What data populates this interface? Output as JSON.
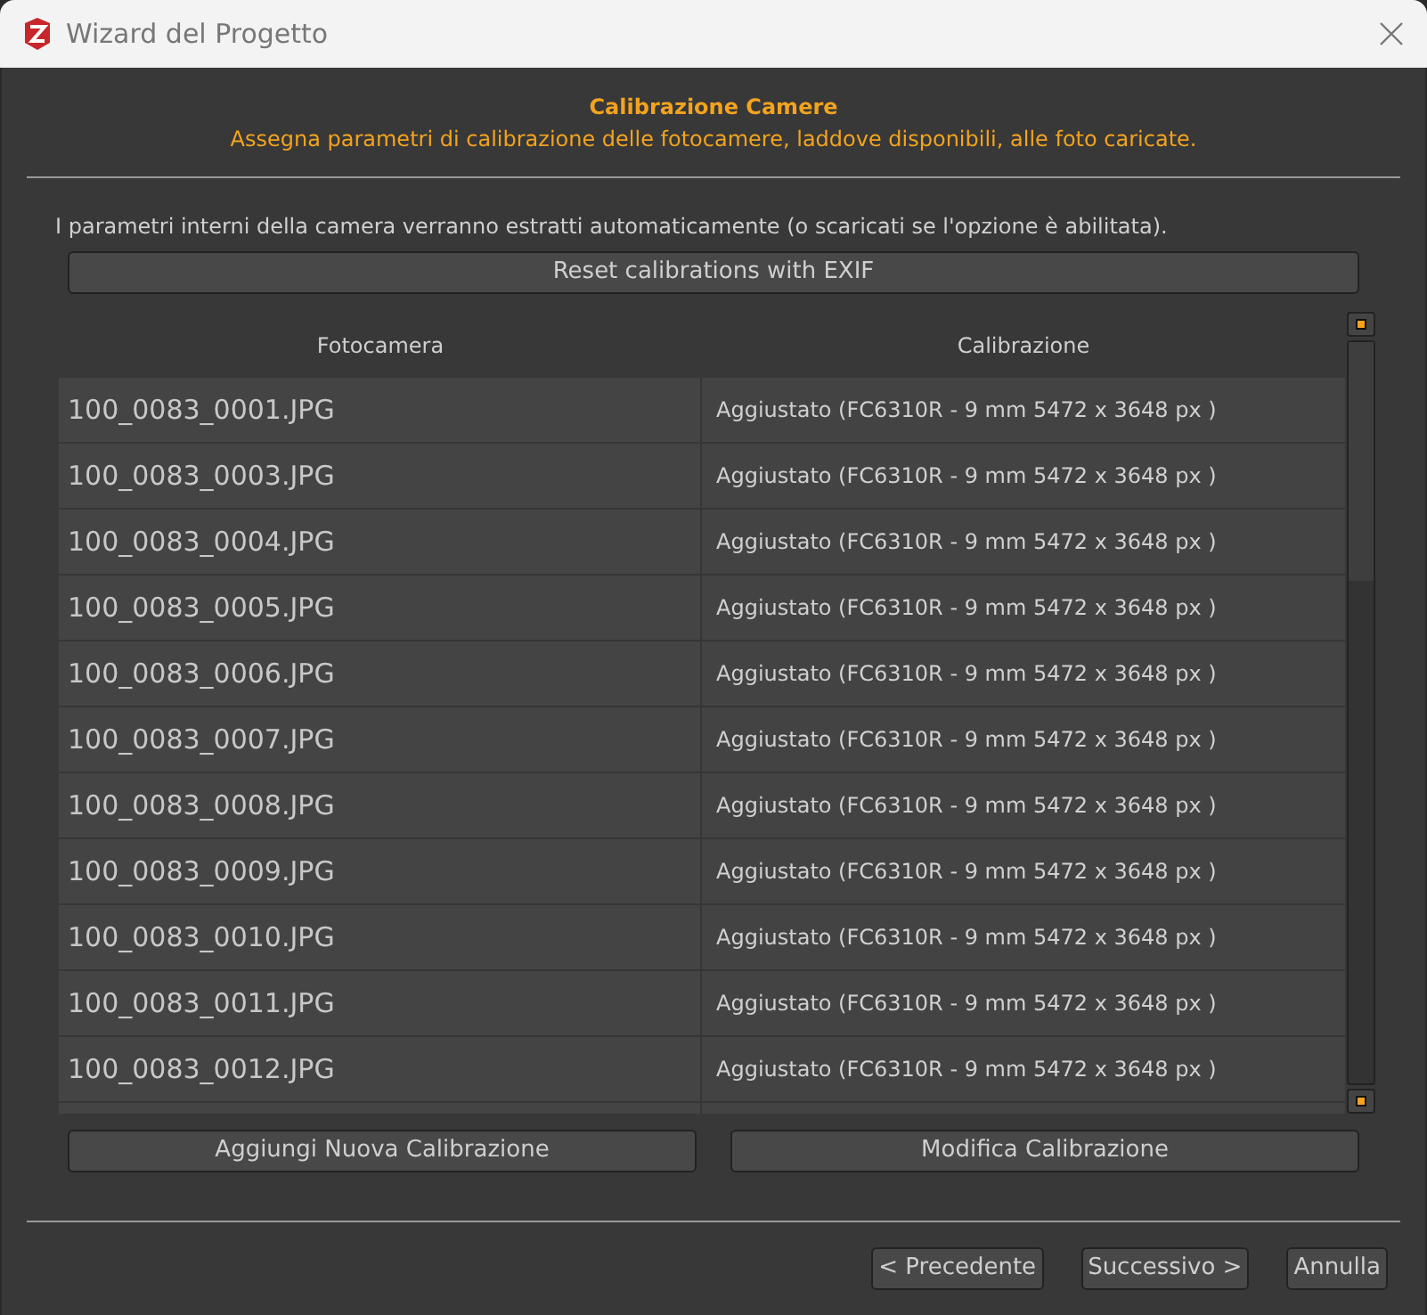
{
  "window": {
    "title": "Wizard del Progetto"
  },
  "header": {
    "title": "Calibrazione Camere",
    "subtitle": "Assegna parametri di calibrazione delle fotocamere, laddove disponibili, alle foto caricate."
  },
  "info": "I parametri interni della camera verranno estratti automaticamente (o scaricati se l'opzione è abilitata).",
  "reset_button": "Reset calibrations with EXIF",
  "table": {
    "columns": [
      "Fotocamera",
      "Calibrazione"
    ],
    "rows": [
      {
        "camera": "100_0083_0001.JPG",
        "calibration": "Aggiustato (FC6310R - 9 mm 5472 x 3648 px )"
      },
      {
        "camera": "100_0083_0003.JPG",
        "calibration": "Aggiustato (FC6310R - 9 mm 5472 x 3648 px )"
      },
      {
        "camera": "100_0083_0004.JPG",
        "calibration": "Aggiustato (FC6310R - 9 mm 5472 x 3648 px )"
      },
      {
        "camera": "100_0083_0005.JPG",
        "calibration": "Aggiustato (FC6310R - 9 mm 5472 x 3648 px )"
      },
      {
        "camera": "100_0083_0006.JPG",
        "calibration": "Aggiustato (FC6310R - 9 mm 5472 x 3648 px )"
      },
      {
        "camera": "100_0083_0007.JPG",
        "calibration": "Aggiustato (FC6310R - 9 mm 5472 x 3648 px )"
      },
      {
        "camera": "100_0083_0008.JPG",
        "calibration": "Aggiustato (FC6310R - 9 mm 5472 x 3648 px )"
      },
      {
        "camera": "100_0083_0009.JPG",
        "calibration": "Aggiustato (FC6310R - 9 mm 5472 x 3648 px )"
      },
      {
        "camera": "100_0083_0010.JPG",
        "calibration": "Aggiustato (FC6310R - 9 mm 5472 x 3648 px )"
      },
      {
        "camera": "100_0083_0011.JPG",
        "calibration": "Aggiustato (FC6310R - 9 mm 5472 x 3648 px )"
      },
      {
        "camera": "100_0083_0012.JPG",
        "calibration": "Aggiustato (FC6310R - 9 mm 5472 x 3648 px )"
      }
    ]
  },
  "action_buttons": [
    "Aggiungi Nuova Calibrazione",
    "Modifica Calibrazione"
  ],
  "footer_buttons": [
    "< Precedente",
    "Successivo >",
    "Annulla"
  ]
}
